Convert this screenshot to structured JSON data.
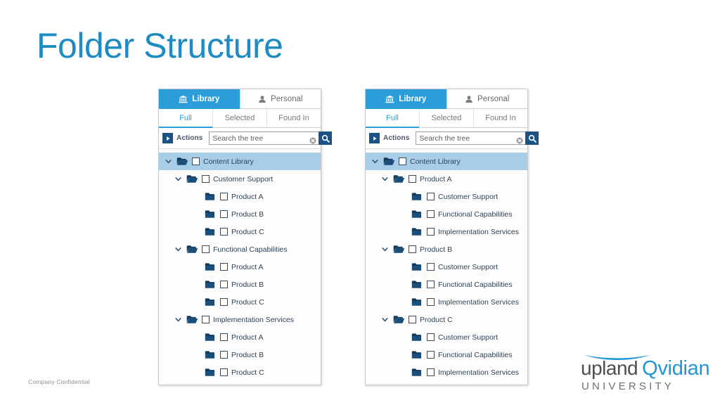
{
  "slide": {
    "title": "Folder Structure",
    "footer": "Company Confidential",
    "title_color": "#1e8bc3"
  },
  "logo": {
    "word1": "upland",
    "word2": "Qvidian",
    "subtitle": "UNIVERSITY",
    "color_primary": "#4c4f53",
    "color_accent": "#2196d6"
  },
  "panel_chrome": {
    "tabs": [
      {
        "label": "Library",
        "icon": "bank-icon",
        "active": true
      },
      {
        "label": "Personal",
        "icon": "person-icon",
        "active": false
      }
    ],
    "subtabs": [
      {
        "label": "Full",
        "active": true
      },
      {
        "label": "Selected",
        "active": false
      },
      {
        "label": "Found In",
        "active": false
      }
    ],
    "actions_label": "Actions",
    "actions_icon": "play-icon",
    "search_placeholder": "Search the tree",
    "search_value": "",
    "clear_icon": "clear-circle-icon",
    "search_icon": "search-icon",
    "accent_color": "#2b9dd9",
    "button_color": "#1b5484",
    "selected_row_color": "#a8cde8"
  },
  "left_tree": {
    "nodes": [
      {
        "label": "Content Library",
        "level": 0,
        "expanded": true,
        "selected": true,
        "folder": "folder-open-icon"
      },
      {
        "label": "Customer Support",
        "level": 1,
        "expanded": true,
        "selected": false,
        "folder": "folder-open-icon"
      },
      {
        "label": "Product A",
        "level": 2,
        "expanded": false,
        "selected": false,
        "folder": "folder-closed-icon"
      },
      {
        "label": "Product B",
        "level": 2,
        "expanded": false,
        "selected": false,
        "folder": "folder-closed-icon"
      },
      {
        "label": "Product C",
        "level": 2,
        "expanded": false,
        "selected": false,
        "folder": "folder-closed-icon"
      },
      {
        "label": "Functional Capabilities",
        "level": 1,
        "expanded": true,
        "selected": false,
        "folder": "folder-open-icon"
      },
      {
        "label": "Product A",
        "level": 2,
        "expanded": false,
        "selected": false,
        "folder": "folder-closed-icon"
      },
      {
        "label": "Product B",
        "level": 2,
        "expanded": false,
        "selected": false,
        "folder": "folder-closed-icon"
      },
      {
        "label": "Product C",
        "level": 2,
        "expanded": false,
        "selected": false,
        "folder": "folder-closed-icon"
      },
      {
        "label": "Implementation Services",
        "level": 1,
        "expanded": true,
        "selected": false,
        "folder": "folder-open-icon"
      },
      {
        "label": "Product A",
        "level": 2,
        "expanded": false,
        "selected": false,
        "folder": "folder-closed-icon"
      },
      {
        "label": "Product B",
        "level": 2,
        "expanded": false,
        "selected": false,
        "folder": "folder-closed-icon"
      },
      {
        "label": "Product C",
        "level": 2,
        "expanded": false,
        "selected": false,
        "folder": "folder-closed-icon"
      }
    ]
  },
  "right_tree": {
    "nodes": [
      {
        "label": "Content Library",
        "level": 0,
        "expanded": true,
        "selected": true,
        "folder": "folder-open-icon"
      },
      {
        "label": "Product A",
        "level": 1,
        "expanded": true,
        "selected": false,
        "folder": "folder-open-icon"
      },
      {
        "label": "Customer Support",
        "level": 2,
        "expanded": false,
        "selected": false,
        "folder": "folder-closed-icon"
      },
      {
        "label": "Functional Capabilities",
        "level": 2,
        "expanded": false,
        "selected": false,
        "folder": "folder-closed-icon"
      },
      {
        "label": "Implementation Services",
        "level": 2,
        "expanded": false,
        "selected": false,
        "folder": "folder-closed-icon"
      },
      {
        "label": "Product B",
        "level": 1,
        "expanded": true,
        "selected": false,
        "folder": "folder-open-icon"
      },
      {
        "label": "Customer Support",
        "level": 2,
        "expanded": false,
        "selected": false,
        "folder": "folder-closed-icon"
      },
      {
        "label": "Functional Capabilities",
        "level": 2,
        "expanded": false,
        "selected": false,
        "folder": "folder-closed-icon"
      },
      {
        "label": "Implementation Services",
        "level": 2,
        "expanded": false,
        "selected": false,
        "folder": "folder-closed-icon"
      },
      {
        "label": "Product C",
        "level": 1,
        "expanded": true,
        "selected": false,
        "folder": "folder-open-icon"
      },
      {
        "label": "Customer Support",
        "level": 2,
        "expanded": false,
        "selected": false,
        "folder": "folder-closed-icon"
      },
      {
        "label": "Functional Capabilities",
        "level": 2,
        "expanded": false,
        "selected": false,
        "folder": "folder-closed-icon"
      },
      {
        "label": "Implementation Services",
        "level": 2,
        "expanded": false,
        "selected": false,
        "folder": "folder-closed-icon"
      }
    ]
  }
}
